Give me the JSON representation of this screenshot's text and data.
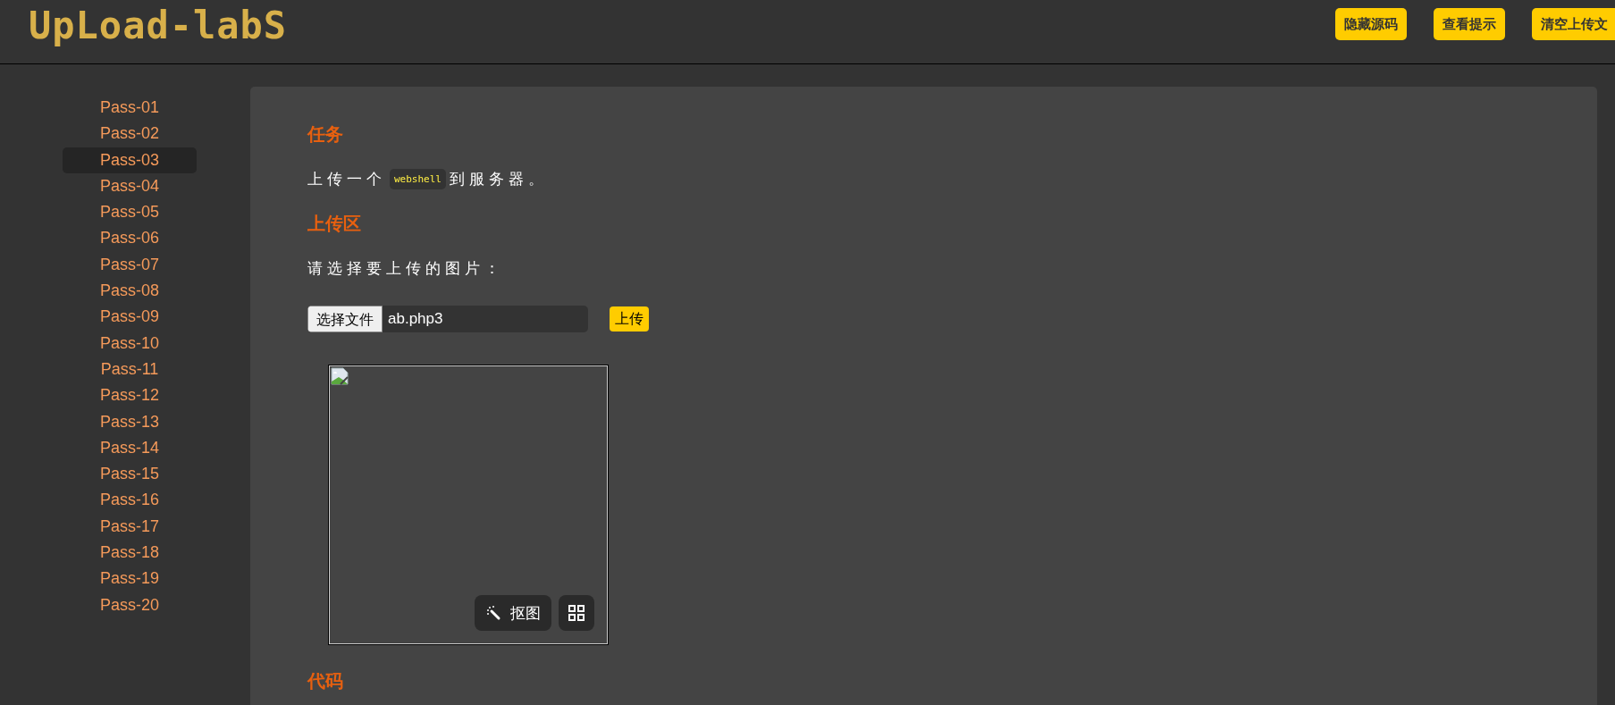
{
  "logo": "UpLoad-labS",
  "header_buttons": [
    "隐藏源码",
    "查看提示",
    "清空上传文"
  ],
  "sidebar": {
    "items": [
      {
        "label": "Pass-01",
        "selected": false
      },
      {
        "label": "Pass-02",
        "selected": false
      },
      {
        "label": "Pass-03",
        "selected": true
      },
      {
        "label": "Pass-04",
        "selected": false
      },
      {
        "label": "Pass-05",
        "selected": false
      },
      {
        "label": "Pass-06",
        "selected": false
      },
      {
        "label": "Pass-07",
        "selected": false
      },
      {
        "label": "Pass-08",
        "selected": false
      },
      {
        "label": "Pass-09",
        "selected": false
      },
      {
        "label": "Pass-10",
        "selected": false
      },
      {
        "label": "Pass-11",
        "selected": false
      },
      {
        "label": "Pass-12",
        "selected": false
      },
      {
        "label": "Pass-13",
        "selected": false
      },
      {
        "label": "Pass-14",
        "selected": false
      },
      {
        "label": "Pass-15",
        "selected": false
      },
      {
        "label": "Pass-16",
        "selected": false
      },
      {
        "label": "Pass-17",
        "selected": false
      },
      {
        "label": "Pass-18",
        "selected": false
      },
      {
        "label": "Pass-19",
        "selected": false
      },
      {
        "label": "Pass-20",
        "selected": false
      }
    ]
  },
  "task": {
    "title": "任务",
    "text_before": "上传一个",
    "code": "webshell",
    "text_after": "到服务器。"
  },
  "upload": {
    "title": "上传区",
    "prompt": "请选择要上传的图片：",
    "file_button": "选择文件",
    "file_name": "ab.php3",
    "submit": "上传",
    "cutout_button": "抠图"
  },
  "code": {
    "title": "代码"
  }
}
